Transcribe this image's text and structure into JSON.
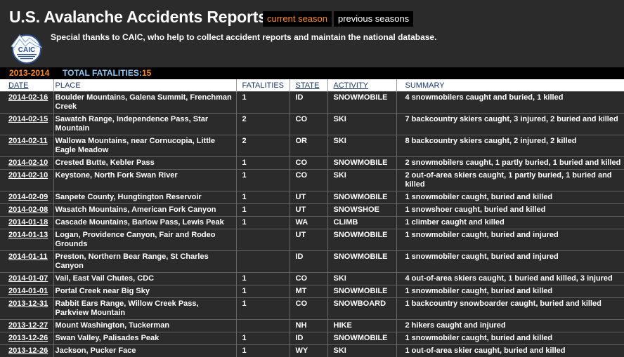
{
  "header": {
    "title": "U.S. Avalanche Accidents Reports",
    "current_season": "current season",
    "previous_seasons": "previous seasons",
    "thanks": "Special thanks to CAIC, who help to collect accident reports and maintain the national database.",
    "logo_text": "CAIC"
  },
  "season_bar": {
    "year": "2013-2014",
    "total_label": "TOTAL FATALITIES:",
    "total_value": "15"
  },
  "colors": {
    "accent": "#ff8a1e",
    "label_blue": "#8ec8f2",
    "background": "#2b2b2b"
  },
  "table": {
    "headers": {
      "date": "DATE",
      "place": "PLACE",
      "fatalities": "FATALITIES",
      "state": "STATE",
      "activity": "ACTIVITY",
      "summary": "SUMMARY"
    },
    "rows": [
      {
        "date": "2014-02-16",
        "place": "Boulder Mountains, Galena Summit, Frenchman Creek",
        "fatalities": "1",
        "state": "ID",
        "activity": "SNOWMOBILE",
        "summary": "4 snowmobilers caught and buried, 1 killed"
      },
      {
        "date": "2014-02-15",
        "place": "Sawatch Range, Independence Pass, Star Mountain",
        "fatalities": "2",
        "state": "CO",
        "activity": "SKI",
        "summary": "7 backcountry skiers caught, 3 injured, 2 buried and killed"
      },
      {
        "date": "2014-02-11",
        "place": "Wallowa Mountains, near Cornucopia, Little Eagle Meadow",
        "fatalities": "2",
        "state": "OR",
        "activity": "SKI",
        "summary": "8 backcountry skiers caught, 2 injured, 2 killed"
      },
      {
        "date": "2014-02-10",
        "place": "Crested Butte, Kebler Pass",
        "fatalities": "1",
        "state": "CO",
        "activity": "SNOWMOBILE",
        "summary": "2 snowmobilers caught, 1 partly buried, 1 buried and killed"
      },
      {
        "date": "2014-02-10",
        "place": "Keystone, North Fork Swan River",
        "fatalities": "1",
        "state": "CO",
        "activity": "SKI",
        "summary": "2 out-of-area skiers caught, 1 partly buried, 1 buried and killed"
      },
      {
        "date": "2014-02-09",
        "place": "Sanpete County, Hungtington Reservoir",
        "fatalities": "1",
        "state": "UT",
        "activity": "SNOWMOBILE",
        "summary": "1 snowmobiler caught, buried and killed"
      },
      {
        "date": "2014-02-08",
        "place": "Wasatch Mountains, American Fork Canyon",
        "fatalities": "1",
        "state": "UT",
        "activity": "SNOWSHOE",
        "summary": "1 snowshoer caught, buried and killed"
      },
      {
        "date": "2014-01-18",
        "place": "Cascade Mountains, Barlow Pass, Lewis Peak",
        "fatalities": "1",
        "state": "WA",
        "activity": "CLIMB",
        "summary": "1 climber caught and killed"
      },
      {
        "date": "2014-01-13",
        "place": "Logan, Providence Canyon, Fair and Rodeo Grounds",
        "fatalities": "",
        "state": "UT",
        "activity": "SNOWMOBILE",
        "summary": "1 snowmobiler caught, buried and injured"
      },
      {
        "date": "2014-01-11",
        "place": "Preston, Northern Bear Range, St Charles Canyon",
        "fatalities": "",
        "state": "ID",
        "activity": "SNOWMOBILE",
        "summary": "1 snowmobiler caught, buried and injured"
      },
      {
        "date": "2014-01-07",
        "place": "Vail, East Vail Chutes, CDC",
        "fatalities": "1",
        "state": "CO",
        "activity": "SKI",
        "summary": "4 out-of-area skiers caught, 1 buried and killed, 3 injured"
      },
      {
        "date": "2014-01-01",
        "place": "Portal Creek near Big Sky",
        "fatalities": "1",
        "state": "MT",
        "activity": "SNOWMOBILE",
        "summary": "1 snowmobiler caught, buried and killed"
      },
      {
        "date": "2013-12-31",
        "place": "Rabbit Ears Range, Willow Creek Pass, Parkview Mountain",
        "fatalities": "1",
        "state": "CO",
        "activity": "SNOWBOARD",
        "summary": "1 backcountry snowboarder caught, buried and killed"
      },
      {
        "date": "2013-12-27",
        "place": "Mount Washington, Tuckerman",
        "fatalities": "",
        "state": "NH",
        "activity": "HIKE",
        "summary": "2 hikers caught and injured"
      },
      {
        "date": "2013-12-26",
        "place": "Swan Valley, Palisades Peak",
        "fatalities": "1",
        "state": "ID",
        "activity": "SNOWMOBILE",
        "summary": "1 snowmobiler caught, buried and killed"
      },
      {
        "date": "2013-12-26",
        "place": "Jackson, Pucker Face",
        "fatalities": "1",
        "state": "WY",
        "activity": "SKI",
        "summary": "1 out-of-area skier caught, buried and killed"
      }
    ]
  }
}
